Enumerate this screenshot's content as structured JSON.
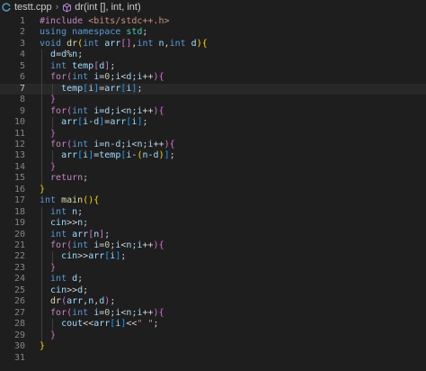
{
  "breadcrumb": {
    "file": "testt.cpp",
    "symbol": "dr(int [], int, int)"
  },
  "colors": {
    "background": "#1e1e1e",
    "line_number": "#858585",
    "keyword": "#569cd6",
    "control": "#c586c0",
    "string": "#ce9178",
    "number": "#b5cea8",
    "function": "#dcdcaa",
    "variable": "#9cdcfe"
  },
  "current_line": 7,
  "lines": [
    {
      "n": "1",
      "indent": 0,
      "tokens": [
        [
          "pre",
          "#include "
        ],
        [
          "str",
          "<bits/stdc++.h>"
        ]
      ]
    },
    {
      "n": "2",
      "indent": 0,
      "tokens": [
        [
          "kw",
          "using "
        ],
        [
          "kw",
          "namespace "
        ],
        [
          "ty",
          "std"
        ],
        [
          "op",
          ";"
        ]
      ]
    },
    {
      "n": "3",
      "indent": 0,
      "tokens": [
        [
          "kw",
          "void "
        ],
        [
          "fn",
          "dr"
        ],
        [
          "b1",
          "("
        ],
        [
          "kw",
          "int "
        ],
        [
          "var",
          "arr"
        ],
        [
          "b2",
          "[]"
        ],
        [
          "op",
          ","
        ],
        [
          "kw",
          "int "
        ],
        [
          "var",
          "n"
        ],
        [
          "op",
          ","
        ],
        [
          "kw",
          "int "
        ],
        [
          "var",
          "d"
        ],
        [
          "b1",
          ")"
        ],
        [
          "b1",
          "{"
        ]
      ]
    },
    {
      "n": "4",
      "indent": 1,
      "tokens": [
        [
          "var",
          "d"
        ],
        [
          "op",
          "="
        ],
        [
          "var",
          "d"
        ],
        [
          "op",
          "%"
        ],
        [
          "var",
          "n"
        ],
        [
          "op",
          ";"
        ]
      ]
    },
    {
      "n": "5",
      "indent": 1,
      "tokens": [
        [
          "kw",
          "int "
        ],
        [
          "var",
          "temp"
        ],
        [
          "b2",
          "["
        ],
        [
          "var",
          "d"
        ],
        [
          "b2",
          "]"
        ],
        [
          "op",
          ";"
        ]
      ]
    },
    {
      "n": "6",
      "indent": 1,
      "tokens": [
        [
          "ctl",
          "for"
        ],
        [
          "b2",
          "("
        ],
        [
          "kw",
          "int "
        ],
        [
          "var",
          "i"
        ],
        [
          "op",
          "="
        ],
        [
          "num",
          "0"
        ],
        [
          "op",
          ";"
        ],
        [
          "var",
          "i"
        ],
        [
          "op",
          "<"
        ],
        [
          "var",
          "d"
        ],
        [
          "op",
          ";"
        ],
        [
          "var",
          "i"
        ],
        [
          "op",
          "++"
        ],
        [
          "b2",
          ")"
        ],
        [
          "b2",
          "{"
        ]
      ]
    },
    {
      "n": "7",
      "indent": 2,
      "tokens": [
        [
          "var",
          "temp"
        ],
        [
          "b3",
          "["
        ],
        [
          "var",
          "i"
        ],
        [
          "b3",
          "]"
        ],
        [
          "op",
          "="
        ],
        [
          "var",
          "arr"
        ],
        [
          "b3",
          "["
        ],
        [
          "var",
          "i"
        ],
        [
          "b3",
          "]"
        ],
        [
          "op",
          ";"
        ]
      ]
    },
    {
      "n": "8",
      "indent": 1,
      "tokens": [
        [
          "b2",
          "}"
        ]
      ]
    },
    {
      "n": "9",
      "indent": 1,
      "tokens": [
        [
          "ctl",
          "for"
        ],
        [
          "b2",
          "("
        ],
        [
          "kw",
          "int "
        ],
        [
          "var",
          "i"
        ],
        [
          "op",
          "="
        ],
        [
          "var",
          "d"
        ],
        [
          "op",
          ";"
        ],
        [
          "var",
          "i"
        ],
        [
          "op",
          "<"
        ],
        [
          "var",
          "n"
        ],
        [
          "op",
          ";"
        ],
        [
          "var",
          "i"
        ],
        [
          "op",
          "++"
        ],
        [
          "b2",
          ")"
        ],
        [
          "b2",
          "{"
        ]
      ]
    },
    {
      "n": "10",
      "indent": 2,
      "tokens": [
        [
          "var",
          "arr"
        ],
        [
          "b3",
          "["
        ],
        [
          "var",
          "i"
        ],
        [
          "op",
          "-"
        ],
        [
          "var",
          "d"
        ],
        [
          "b3",
          "]"
        ],
        [
          "op",
          "="
        ],
        [
          "var",
          "arr"
        ],
        [
          "b3",
          "["
        ],
        [
          "var",
          "i"
        ],
        [
          "b3",
          "]"
        ],
        [
          "op",
          ";"
        ]
      ]
    },
    {
      "n": "11",
      "indent": 1,
      "tokens": [
        [
          "b2",
          "}"
        ]
      ]
    },
    {
      "n": "12",
      "indent": 1,
      "tokens": [
        [
          "ctl",
          "for"
        ],
        [
          "b2",
          "("
        ],
        [
          "kw",
          "int "
        ],
        [
          "var",
          "i"
        ],
        [
          "op",
          "="
        ],
        [
          "var",
          "n"
        ],
        [
          "op",
          "-"
        ],
        [
          "var",
          "d"
        ],
        [
          "op",
          ";"
        ],
        [
          "var",
          "i"
        ],
        [
          "op",
          "<"
        ],
        [
          "var",
          "n"
        ],
        [
          "op",
          ";"
        ],
        [
          "var",
          "i"
        ],
        [
          "op",
          "++"
        ],
        [
          "b2",
          ")"
        ],
        [
          "b2",
          "{"
        ]
      ]
    },
    {
      "n": "13",
      "indent": 2,
      "tokens": [
        [
          "var",
          "arr"
        ],
        [
          "b3",
          "["
        ],
        [
          "var",
          "i"
        ],
        [
          "b3",
          "]"
        ],
        [
          "op",
          "="
        ],
        [
          "var",
          "temp"
        ],
        [
          "b3",
          "["
        ],
        [
          "var",
          "i"
        ],
        [
          "op",
          "-"
        ],
        [
          "b1",
          "("
        ],
        [
          "var",
          "n"
        ],
        [
          "op",
          "-"
        ],
        [
          "var",
          "d"
        ],
        [
          "b1",
          ")"
        ],
        [
          "b3",
          "]"
        ],
        [
          "op",
          ";"
        ]
      ]
    },
    {
      "n": "14",
      "indent": 1,
      "tokens": [
        [
          "b2",
          "}"
        ]
      ]
    },
    {
      "n": "15",
      "indent": 1,
      "tokens": [
        [
          "ctl",
          "return"
        ],
        [
          "op",
          ";"
        ]
      ]
    },
    {
      "n": "16",
      "indent": 0,
      "tokens": [
        [
          "b1",
          "}"
        ]
      ]
    },
    {
      "n": "17",
      "indent": 0,
      "tokens": [
        [
          "kw",
          "int "
        ],
        [
          "fn",
          "main"
        ],
        [
          "b1",
          "()"
        ],
        [
          "b1",
          "{"
        ]
      ]
    },
    {
      "n": "18",
      "indent": 1,
      "tokens": [
        [
          "kw",
          "int "
        ],
        [
          "var",
          "n"
        ],
        [
          "op",
          ";"
        ]
      ]
    },
    {
      "n": "19",
      "indent": 1,
      "tokens": [
        [
          "var",
          "cin"
        ],
        [
          "op",
          ">>"
        ],
        [
          "var",
          "n"
        ],
        [
          "op",
          ";"
        ]
      ]
    },
    {
      "n": "20",
      "indent": 1,
      "tokens": [
        [
          "kw",
          "int "
        ],
        [
          "var",
          "arr"
        ],
        [
          "b2",
          "["
        ],
        [
          "var",
          "n"
        ],
        [
          "b2",
          "]"
        ],
        [
          "op",
          ";"
        ]
      ]
    },
    {
      "n": "21",
      "indent": 1,
      "tokens": [
        [
          "ctl",
          "for"
        ],
        [
          "b2",
          "("
        ],
        [
          "kw",
          "int "
        ],
        [
          "var",
          "i"
        ],
        [
          "op",
          "="
        ],
        [
          "num",
          "0"
        ],
        [
          "op",
          ";"
        ],
        [
          "var",
          "i"
        ],
        [
          "op",
          "<"
        ],
        [
          "var",
          "n"
        ],
        [
          "op",
          ";"
        ],
        [
          "var",
          "i"
        ],
        [
          "op",
          "++"
        ],
        [
          "b2",
          ")"
        ],
        [
          "b2",
          "{"
        ]
      ]
    },
    {
      "n": "22",
      "indent": 2,
      "tokens": [
        [
          "var",
          "cin"
        ],
        [
          "op",
          ">>"
        ],
        [
          "var",
          "arr"
        ],
        [
          "b3",
          "["
        ],
        [
          "var",
          "i"
        ],
        [
          "b3",
          "]"
        ],
        [
          "op",
          ";"
        ]
      ]
    },
    {
      "n": "23",
      "indent": 1,
      "tokens": [
        [
          "b2",
          "}"
        ]
      ]
    },
    {
      "n": "24",
      "indent": 1,
      "tokens": [
        [
          "kw",
          "int "
        ],
        [
          "var",
          "d"
        ],
        [
          "op",
          ";"
        ]
      ]
    },
    {
      "n": "25",
      "indent": 1,
      "tokens": [
        [
          "var",
          "cin"
        ],
        [
          "op",
          ">>"
        ],
        [
          "var",
          "d"
        ],
        [
          "op",
          ";"
        ]
      ]
    },
    {
      "n": "26",
      "indent": 1,
      "tokens": [
        [
          "fn",
          "dr"
        ],
        [
          "b2",
          "("
        ],
        [
          "var",
          "arr"
        ],
        [
          "op",
          ","
        ],
        [
          "var",
          "n"
        ],
        [
          "op",
          ","
        ],
        [
          "var",
          "d"
        ],
        [
          "b2",
          ")"
        ],
        [
          "op",
          ";"
        ]
      ]
    },
    {
      "n": "27",
      "indent": 1,
      "tokens": [
        [
          "ctl",
          "for"
        ],
        [
          "b2",
          "("
        ],
        [
          "kw",
          "int "
        ],
        [
          "var",
          "i"
        ],
        [
          "op",
          "="
        ],
        [
          "num",
          "0"
        ],
        [
          "op",
          ";"
        ],
        [
          "var",
          "i"
        ],
        [
          "op",
          "<"
        ],
        [
          "var",
          "n"
        ],
        [
          "op",
          ";"
        ],
        [
          "var",
          "i"
        ],
        [
          "op",
          "++"
        ],
        [
          "b2",
          ")"
        ],
        [
          "b2",
          "{"
        ]
      ]
    },
    {
      "n": "28",
      "indent": 2,
      "tokens": [
        [
          "var",
          "cout"
        ],
        [
          "op",
          "<<"
        ],
        [
          "var",
          "arr"
        ],
        [
          "b3",
          "["
        ],
        [
          "var",
          "i"
        ],
        [
          "b3",
          "]"
        ],
        [
          "op",
          "<<"
        ],
        [
          "str",
          "\" \""
        ],
        [
          "op",
          ";"
        ]
      ]
    },
    {
      "n": "29",
      "indent": 1,
      "tokens": [
        [
          "b2",
          "}"
        ]
      ]
    },
    {
      "n": "30",
      "indent": 0,
      "tokens": [
        [
          "b1",
          "}"
        ]
      ]
    },
    {
      "n": "31",
      "indent": 0,
      "tokens": []
    }
  ]
}
